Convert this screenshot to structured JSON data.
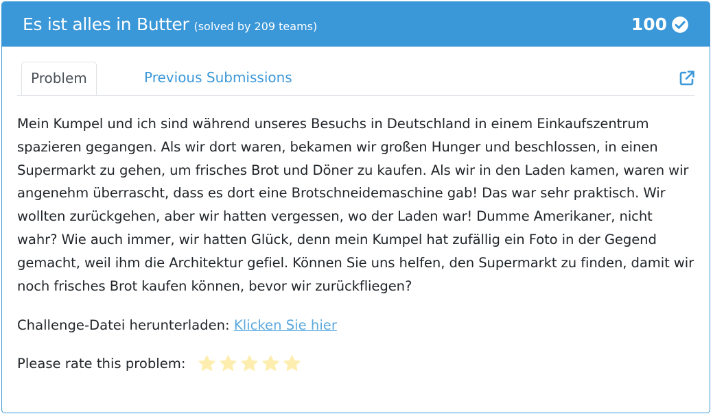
{
  "header": {
    "title": "Es ist alles in Butter",
    "solved": "(solved by 209 teams)",
    "score": "100",
    "color": "#3a97d8"
  },
  "tabs": [
    {
      "label": "Problem",
      "active": true
    },
    {
      "label": "Previous Submissions",
      "active": false
    }
  ],
  "description": "Mein Kumpel und ich sind während unseres Besuchs in Deutschland in einem Einkaufszentrum spazieren gegangen. Als wir dort waren, bekamen wir großen Hunger und beschlossen, in einen Supermarkt zu gehen, um frisches Brot und Döner zu kaufen. Als wir in den Laden kamen, waren wir angenehm überrascht, dass es dort eine Brotschneidemaschine gab! Das war sehr praktisch. Wir wollten zurückgehen, aber wir hatten vergessen, wo der Laden war! Dumme Amerikaner, nicht wahr? Wie auch immer, wir hatten Glück, denn mein Kumpel hat zufällig ein Foto in der Gegend gemacht, weil ihm die Architektur gefiel. Können Sie uns helfen, den Supermarkt zu finden, damit wir noch frisches Brot kaufen können, bevor wir zurückfliegen?",
  "download": {
    "label": "Challenge-Datei herunterladen:",
    "link_text": "Klicken Sie hier"
  },
  "rating": {
    "label": "Please rate this problem:",
    "stars": 5,
    "rated": 0,
    "star_color": "#fdeeb0"
  },
  "icons": {
    "solved": "check-circle-icon",
    "external": "external-link-icon",
    "star": "star-icon"
  }
}
